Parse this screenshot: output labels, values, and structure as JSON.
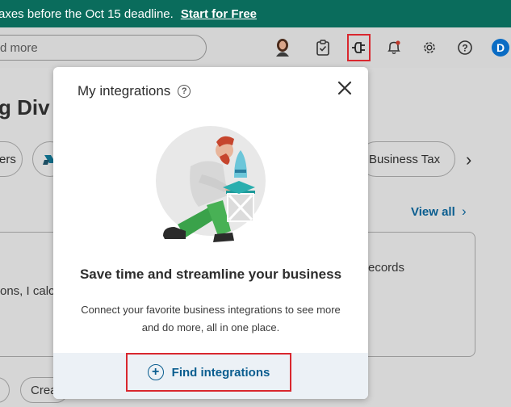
{
  "banner": {
    "text": "axes before the Oct 15 deadline.",
    "link": "Start for Free",
    "bg": "#0a6c5c"
  },
  "header": {
    "search_placeholder": "d more",
    "user_initial": "D"
  },
  "background": {
    "title": "g Div",
    "pill_others": "ers",
    "pill_tax": "Business Tax",
    "view_all": "View all",
    "card_text_left": "ons, I calc",
    "card_text_right": "ecords",
    "chip_create": "Crea"
  },
  "modal": {
    "title": "My integrations",
    "headline": "Save time and streamline your business",
    "description": "Connect your favorite business integrations to see more and do more, all in one place.",
    "find_button": "Find integrations"
  },
  "colors": {
    "accent": "#0a5d8f",
    "highlight": "#d9272e"
  }
}
